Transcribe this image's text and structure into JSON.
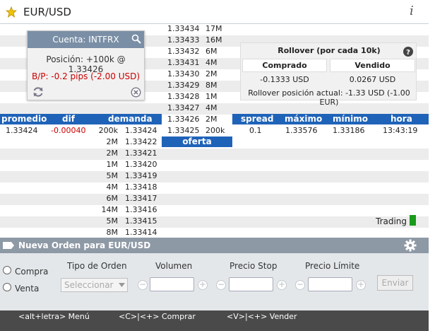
{
  "window": {
    "title": "EUR/USD",
    "info_icon": "i"
  },
  "depth": {
    "asks": [
      {
        "price": "1.33434",
        "size": "17M"
      },
      {
        "price": "1.33433",
        "size": "16M"
      },
      {
        "price": "1.33432",
        "size": "6M"
      },
      {
        "price": "1.33431",
        "size": "4M"
      },
      {
        "price": "1.33430",
        "size": "2M"
      },
      {
        "price": "1.33429",
        "size": "8M"
      },
      {
        "price": "1.33428",
        "size": "1M"
      },
      {
        "price": "1.33427",
        "size": "4M"
      },
      {
        "price": "1.33426",
        "size": "2M"
      },
      {
        "price": "1.33425",
        "size": "200k"
      }
    ],
    "oferta_label": "oferta",
    "bids": [
      {
        "size": "200k",
        "price": "1.33424"
      },
      {
        "size": "2M",
        "price": "1.33422"
      },
      {
        "size": "2M",
        "price": "1.33421"
      },
      {
        "size": "1M",
        "price": "1.33420"
      },
      {
        "size": "5M",
        "price": "1.33419"
      },
      {
        "size": "4M",
        "price": "1.33418"
      },
      {
        "size": "6M",
        "price": "1.33417"
      },
      {
        "size": "14M",
        "price": "1.33416"
      },
      {
        "size": "5M",
        "price": "1.33415"
      },
      {
        "size": "8M",
        "price": "1.33414"
      }
    ]
  },
  "account": {
    "title": "Cuenta: INTFRX",
    "position": "Posición: +100k @ 1.33426",
    "pnl": "B/P: -0.2 pips (-2.00 USD)"
  },
  "rollover": {
    "title": "Rollover (por cada 10k)",
    "col_bought": "Comprado",
    "col_sold": "Vendido",
    "bought_value": "-0.1333 USD",
    "sold_value": "0.0267 USD",
    "current": "Rollover posición actual: -1.33 USD (-1.00 EUR)"
  },
  "quote_left": {
    "headers": [
      "promedio",
      "dif",
      "demanda"
    ],
    "promedio": "1.33424",
    "dif": "-0.00040"
  },
  "quote_right": {
    "headers": [
      "spread",
      "máximo",
      "mínimo",
      "hora"
    ],
    "spread": "0.1",
    "max": "1.33576",
    "min": "1.33186",
    "hora": "13:43:19"
  },
  "trading": {
    "label": "Trading",
    "status_color": "#1a9a1a"
  },
  "order": {
    "title": "Nueva Orden para EUR/USD",
    "buy_label": "Compra",
    "sell_label": "Venta",
    "order_type_label": "Tipo de Orden",
    "order_type_value": "Seleccionar",
    "volume_label": "Volumen",
    "stop_label": "Precio Stop",
    "limit_label": "Precio Límite",
    "send_label": "Enviar",
    "minus": "−",
    "plus": "+"
  },
  "footer": {
    "menu": "<alt+letra> Menú",
    "buy": "<C>|<+> Comprar",
    "sell": "<V>|<+> Vender"
  },
  "colors": {
    "accent_blue": "#1f63b8",
    "negative": "#cc0000",
    "order_bar": "#8e99a6",
    "footer_bg": "#4a4a4a"
  }
}
